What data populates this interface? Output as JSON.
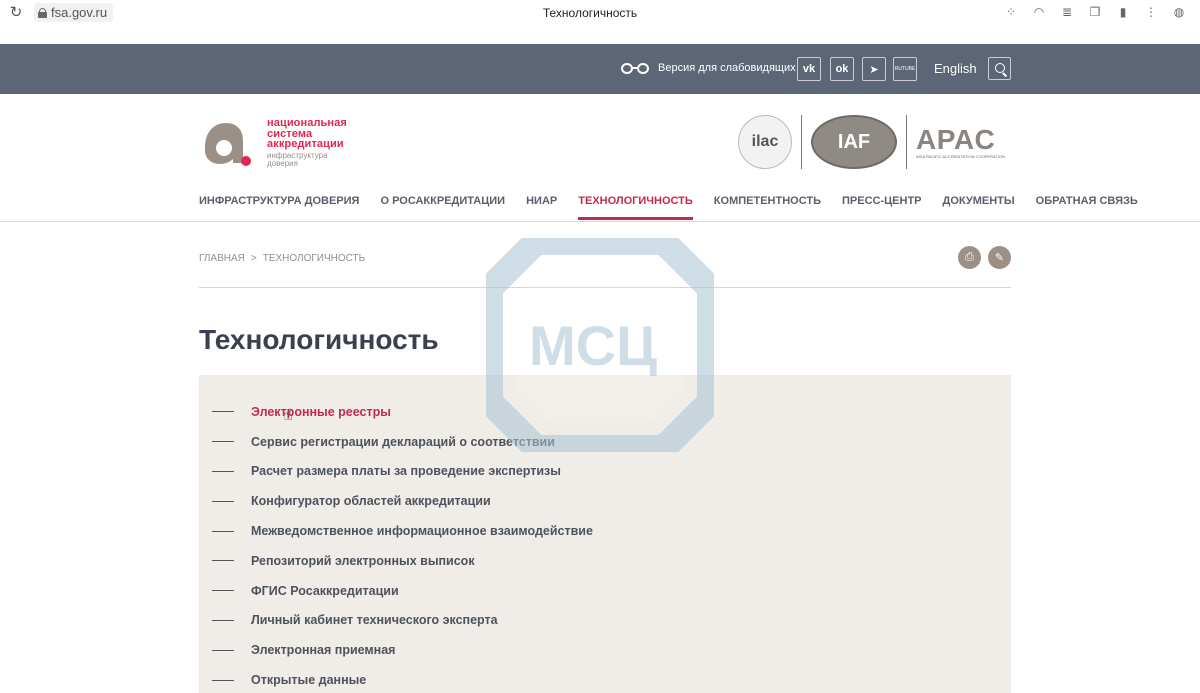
{
  "browser": {
    "url": "fsa.gov.ru",
    "tab_title": "Технологичность"
  },
  "topbar": {
    "low_vision_label": "Версия для слабовидящих",
    "social": [
      "vk",
      "ok",
      "telegram",
      "rutube"
    ],
    "rutube_label": "RUTUBE",
    "language": "English"
  },
  "header": {
    "logo_lines": [
      "национальная",
      "система",
      "аккредитации"
    ],
    "logo_sub": [
      "инфраструктура",
      "доверия"
    ],
    "partners": {
      "ilac": "ilac",
      "iaf": "IAF",
      "apac": "APAC",
      "apac_sub": "ASIA PACIFIC ACCREDITATION COOPERATION"
    }
  },
  "nav": {
    "items": [
      "ИНФРАСТРУКТУРА ДОВЕРИЯ",
      "О РОСАККРЕДИТАЦИИ",
      "НИАР",
      "ТЕХНОЛОГИЧНОСТЬ",
      "КОМПЕТЕНТНОСТЬ",
      "ПРЕСС-ЦЕНТР",
      "ДОКУМЕНТЫ",
      "ОБРАТНАЯ СВЯЗЬ"
    ],
    "active_index": 3
  },
  "breadcrumb": {
    "home": "ГЛАВНАЯ",
    "separator": ">",
    "current": "ТЕХНОЛОГИЧНОСТЬ"
  },
  "watermark_text": "МСЦ",
  "page_title": "Технологичность",
  "links": [
    "Электронные реестры",
    "Сервис регистрации деклараций о соответствии",
    "Расчет размера платы за проведение экспертизы",
    "Конфигуратор областей аккредитации",
    "Межведомственное информационное взаимодействие",
    "Репозиторий электронных выписок",
    "ФГИС Росаккредитации",
    "Личный кабинет технического эксперта",
    "Электронная приемная",
    "Открытые данные"
  ],
  "active_link_index": 0,
  "colors": {
    "accent": "#c6294e",
    "topbar": "#5d6677",
    "panel": "#f0ede8"
  }
}
